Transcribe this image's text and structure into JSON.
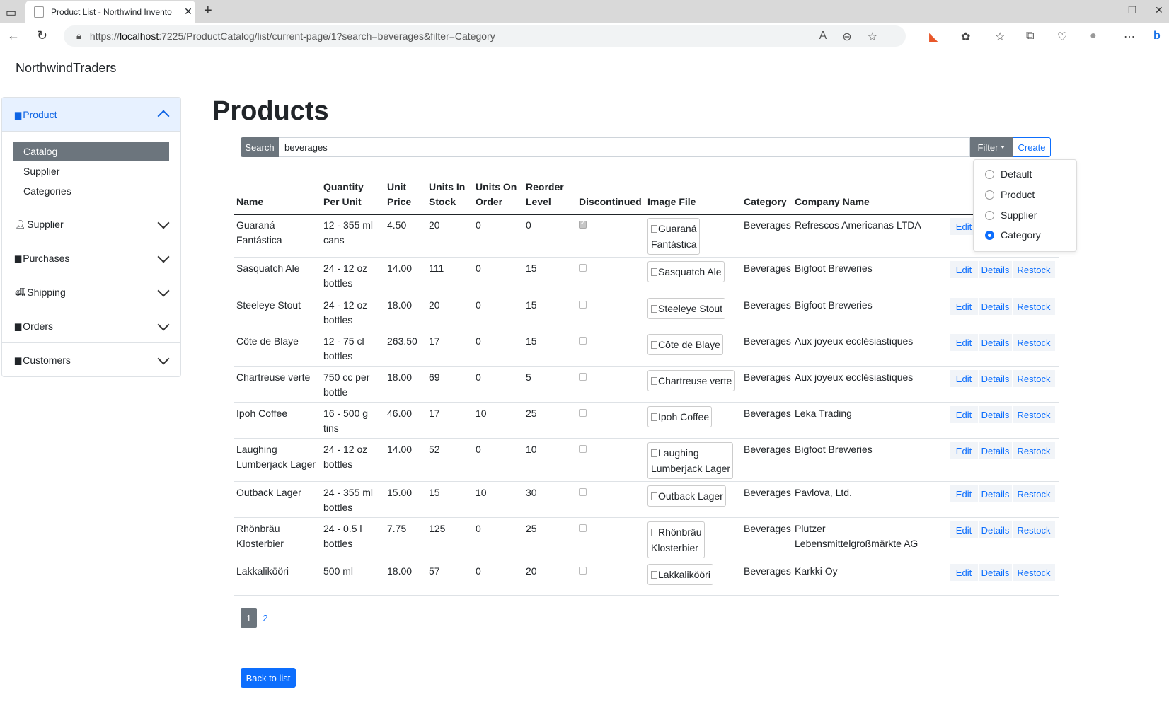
{
  "browser": {
    "tab_title": "Product List - Northwind Invento",
    "url_prefix": "https://",
    "url_host": "localhost",
    "url_rest": ":7225/ProductCatalog/list/current-page/1?search=beverages&filter=Category"
  },
  "app": {
    "brand": "NorthwindTraders"
  },
  "sidebar": {
    "sections": [
      {
        "label": "Product",
        "icon": "box-icon",
        "expanded": true,
        "items": [
          {
            "label": "Catalog",
            "active": true
          },
          {
            "label": "Supplier"
          },
          {
            "label": "Categories"
          }
        ]
      },
      {
        "label": "Supplier",
        "icon": "person-icon"
      },
      {
        "label": "Purchases",
        "icon": "document-icon"
      },
      {
        "label": "Shipping",
        "icon": "truck-icon"
      },
      {
        "label": "Orders",
        "icon": "document-icon"
      },
      {
        "label": "Customers",
        "icon": "document-icon"
      }
    ]
  },
  "main": {
    "title": "Products",
    "search": {
      "button": "Search",
      "value": "beverages"
    },
    "filter_button": "Filter",
    "create_button": "Create",
    "filter_options": [
      {
        "label": "Default",
        "selected": false
      },
      {
        "label": "Product",
        "selected": false
      },
      {
        "label": "Supplier",
        "selected": false
      },
      {
        "label": "Category",
        "selected": true
      }
    ],
    "columns": {
      "name": "Name",
      "qty": [
        "Quantity",
        "Per Unit"
      ],
      "price": [
        "Unit",
        "Price"
      ],
      "stock": [
        "Units In",
        "Stock"
      ],
      "order": [
        "Units On",
        "Order"
      ],
      "reorder": [
        "Reorder",
        "Level"
      ],
      "discontinued": "Discontinued",
      "image": "Image File",
      "category": "Category",
      "company": "Company Name"
    },
    "action_labels": {
      "edit": "Edit",
      "details": "Details",
      "restock": "Restock"
    },
    "rows": [
      {
        "name": [
          "Guaraná",
          "Fantástica"
        ],
        "qty": [
          "12 - 355 ml",
          "cans"
        ],
        "price": "4.50",
        "stock": "20",
        "order": "0",
        "reorder": "0",
        "discontinued": true,
        "image": [
          "Guaraná",
          "Fantástica"
        ],
        "category": "Beverages",
        "company": [
          "Refrescos Americanas LTDA"
        ]
      },
      {
        "name": [
          "Sasquatch Ale"
        ],
        "qty": [
          "24 - 12 oz",
          "bottles"
        ],
        "price": "14.00",
        "stock": "111",
        "order": "0",
        "reorder": "15",
        "discontinued": false,
        "image": [
          "Sasquatch Ale"
        ],
        "category": "Beverages",
        "company": [
          "Bigfoot Breweries"
        ]
      },
      {
        "name": [
          "Steeleye Stout"
        ],
        "qty": [
          "24 - 12 oz",
          "bottles"
        ],
        "price": "18.00",
        "stock": "20",
        "order": "0",
        "reorder": "15",
        "discontinued": false,
        "image": [
          "Steeleye Stout"
        ],
        "category": "Beverages",
        "company": [
          "Bigfoot Breweries"
        ]
      },
      {
        "name": [
          "Côte de Blaye"
        ],
        "qty": [
          "12 - 75 cl",
          "bottles"
        ],
        "price": "263.50",
        "stock": "17",
        "order": "0",
        "reorder": "15",
        "discontinued": false,
        "image": [
          "Côte de Blaye"
        ],
        "category": "Beverages",
        "company": [
          "Aux joyeux ecclésiastiques"
        ]
      },
      {
        "name": [
          "Chartreuse verte"
        ],
        "qty": [
          "750 cc per",
          "bottle"
        ],
        "price": "18.00",
        "stock": "69",
        "order": "0",
        "reorder": "5",
        "discontinued": false,
        "image": [
          "Chartreuse verte"
        ],
        "category": "Beverages",
        "company": [
          "Aux joyeux ecclésiastiques"
        ]
      },
      {
        "name": [
          "Ipoh Coffee"
        ],
        "qty": [
          "16 - 500 g",
          "tins"
        ],
        "price": "46.00",
        "stock": "17",
        "order": "10",
        "reorder": "25",
        "discontinued": false,
        "image": [
          "Ipoh Coffee"
        ],
        "category": "Beverages",
        "company": [
          "Leka Trading"
        ]
      },
      {
        "name": [
          "Laughing",
          "Lumberjack Lager"
        ],
        "qty": [
          "24 - 12 oz",
          "bottles"
        ],
        "price": "14.00",
        "stock": "52",
        "order": "0",
        "reorder": "10",
        "discontinued": false,
        "image": [
          "Laughing",
          "Lumberjack Lager"
        ],
        "category": "Beverages",
        "company": [
          "Bigfoot Breweries"
        ]
      },
      {
        "name": [
          "Outback Lager"
        ],
        "qty": [
          "24 - 355 ml",
          "bottles"
        ],
        "price": "15.00",
        "stock": "15",
        "order": "10",
        "reorder": "30",
        "discontinued": false,
        "image": [
          "Outback Lager"
        ],
        "category": "Beverages",
        "company": [
          "Pavlova, Ltd."
        ]
      },
      {
        "name": [
          "Rhönbräu",
          "Klosterbier"
        ],
        "qty": [
          "24 - 0.5 l",
          "bottles"
        ],
        "price": "7.75",
        "stock": "125",
        "order": "0",
        "reorder": "25",
        "discontinued": false,
        "image": [
          "Rhönbräu",
          "Klosterbier"
        ],
        "category": "Beverages",
        "company": [
          "Plutzer",
          "Lebensmittelgroßmärkte AG"
        ]
      },
      {
        "name": [
          "Lakkalikööri"
        ],
        "qty": [
          "500 ml"
        ],
        "price": "18.00",
        "stock": "57",
        "order": "0",
        "reorder": "20",
        "discontinued": false,
        "image": [
          "Lakkalikööri"
        ],
        "category": "Beverages",
        "company": [
          "Karkki Oy"
        ]
      }
    ],
    "pagination": {
      "pages": [
        "1",
        "2"
      ],
      "current": "1"
    },
    "back_button": "Back to list"
  },
  "colors": {
    "primary": "#0d6efd",
    "secondary": "#6c757d",
    "accordion_active_bg": "#e7f1ff"
  }
}
